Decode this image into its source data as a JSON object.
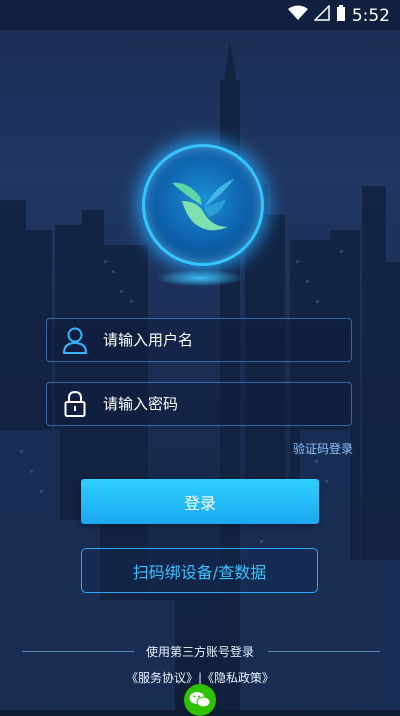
{
  "status_bar": {
    "time": "5:52"
  },
  "login": {
    "username_placeholder": "请输入用户名",
    "password_placeholder": "请输入密码",
    "sms_login_link": "验证码登录",
    "login_button": "登录",
    "scan_button": "扫码绑设备/查数据"
  },
  "footer": {
    "third_party_label": "使用第三方账号登录",
    "terms_text": "《服务协议》|《隐私政策》"
  },
  "colors": {
    "accent": "#1ba8f0",
    "scan_border": "#2aa9ff",
    "wechat": "#2dc100"
  },
  "icons": [
    "wifi-icon",
    "signal-icon",
    "battery-icon",
    "user-icon",
    "lock-icon",
    "wechat-icon",
    "app-logo"
  ]
}
